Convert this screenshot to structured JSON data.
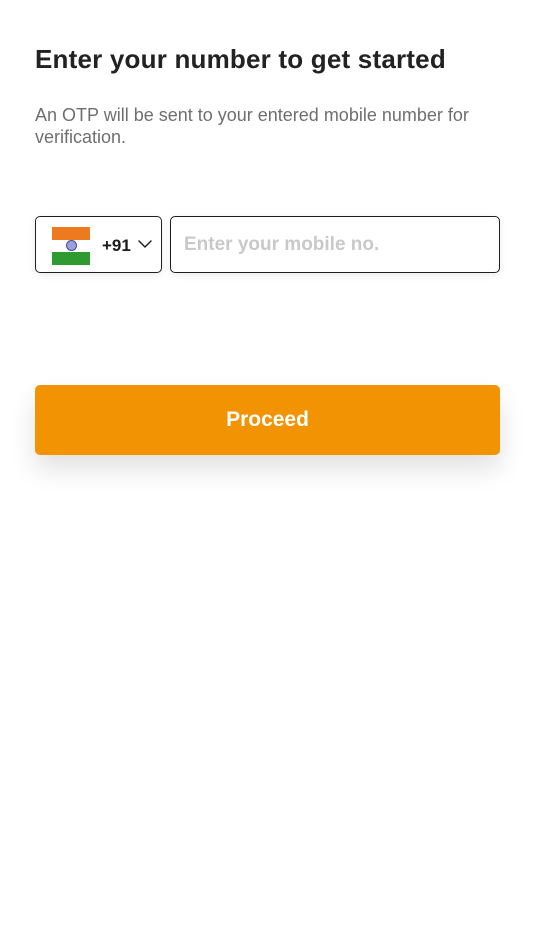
{
  "header": {
    "title": "Enter your number to get started",
    "subtitle": "An OTP will be sent to your entered mobile number for verification."
  },
  "phone_form": {
    "country": {
      "flag_icon": "india-flag-icon",
      "dial_code": "+91",
      "dropdown_icon": "chevron-down-icon"
    },
    "mobile_input": {
      "value": "",
      "placeholder": "Enter your mobile no."
    }
  },
  "actions": {
    "proceed_label": "Proceed"
  },
  "colors": {
    "accent": "#f19303",
    "title_text": "#222222",
    "subtitle_text": "#6f6f6f",
    "placeholder_text": "#c9c9c9",
    "border": "#1f1f1f"
  }
}
